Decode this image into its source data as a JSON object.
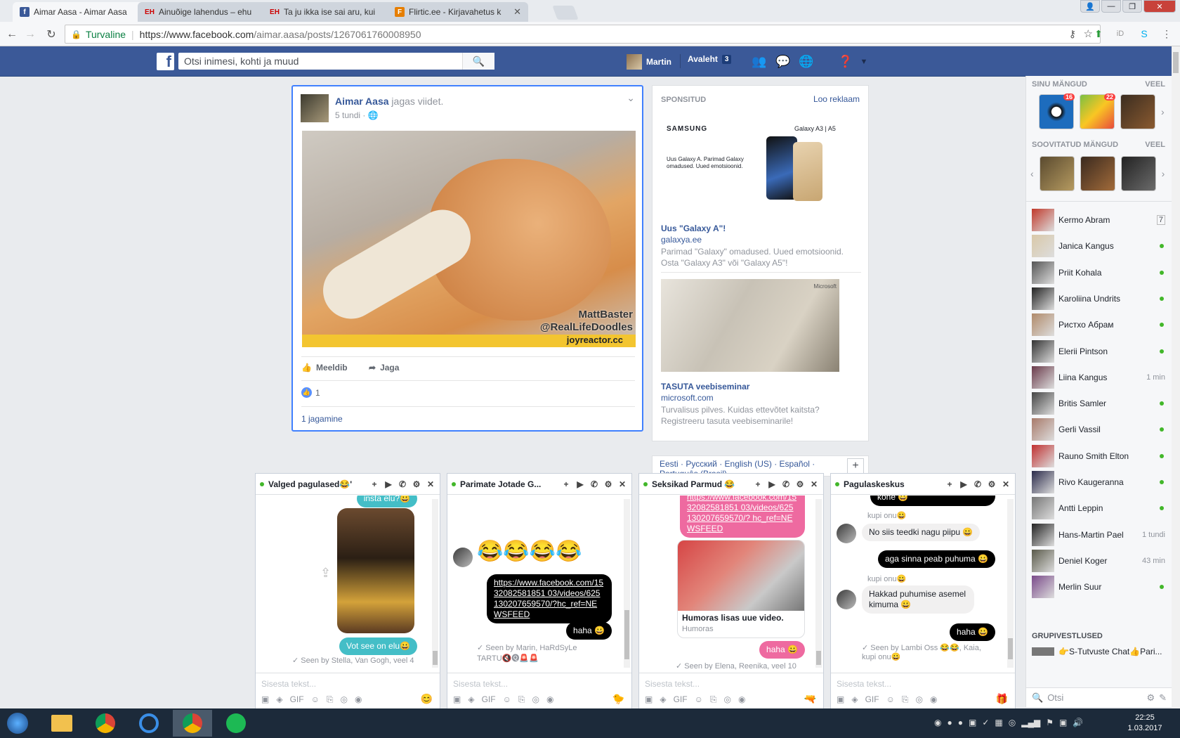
{
  "browser": {
    "tabs": [
      {
        "title": "Aimar Aasa - Aimar Aasa",
        "favicon": "facebook-icon",
        "active": true
      },
      {
        "title": "Ainuõige lahendus – ehu",
        "favicon": "eh-icon",
        "active": false
      },
      {
        "title": "Ta ju ikka ise sai aru, kui",
        "favicon": "eh-icon",
        "active": false
      },
      {
        "title": "Flirtic.ee - Kirjavahetus k",
        "favicon": "flirtic-icon",
        "active": false
      }
    ],
    "security_label": "Turvaline",
    "url_host": "https://www.facebook.com",
    "url_path": "/aimar.aasa/posts/1267061760008950"
  },
  "fb_header": {
    "search_placeholder": "Otsi inimesi, kohti ja muud",
    "user_name": "Martin",
    "home_label": "Avaleht",
    "home_count": "3"
  },
  "post": {
    "author": "Aimar Aasa",
    "action": "jagas viidet.",
    "time": "5 tundi",
    "image_watermark_1": "MattBaster",
    "image_watermark_2": "@RealLifeDoodles",
    "image_source": "joyreactor.cc",
    "like_label": "Meeldib",
    "share_label": "Jaga",
    "like_count": "1",
    "share_count": "1 jagamine"
  },
  "sponsored": {
    "header": "SPONSITUD",
    "create_ad": "Loo reklaam",
    "ads": [
      {
        "brand": "SAMSUNG",
        "product": "Galaxy A3 | A5",
        "img_text": "Uus Galaxy A. Parimad Galaxy omadused. Uued emotsioonid.",
        "title": "Uus \"Galaxy A\"!",
        "domain": "galaxya.ee",
        "desc": "Parimad \"Galaxy\" omadused. Uued emotsioonid. Osta \"Galaxy A3\" või \"Galaxy A5\"!"
      },
      {
        "brand": "Microsoft",
        "title": "TASUTA veebiseminar",
        "domain": "microsoft.com",
        "desc": "Turvalisus pilves. Kuidas ettevõtet kaitsta? Registreeru tasuta veebiseminarile!"
      }
    ]
  },
  "footer": {
    "langs": "Eesti · Русский · English (US) · Español · Português (Brasil)",
    "plus": "+"
  },
  "sidebar": {
    "games_header": "SINU MÄNGUD",
    "more": "VEEL",
    "games_badges": [
      "16",
      "22"
    ],
    "suggested_header": "SOOVITATUD MÄNGUD",
    "friends": [
      {
        "name": "Kermo Abram",
        "status": "7"
      },
      {
        "name": "Janica Kangus",
        "status": "online"
      },
      {
        "name": "Priit Kohala",
        "status": "online"
      },
      {
        "name": "Karoliina Undrits",
        "status": "online"
      },
      {
        "name": "Ристхо Абрам",
        "status": "online"
      },
      {
        "name": "Elerii Pintson",
        "status": "online"
      },
      {
        "name": "Liina Kangus",
        "status": "1 min"
      },
      {
        "name": "Britis Samler",
        "status": "online"
      },
      {
        "name": "Gerli Vassil",
        "status": "online"
      },
      {
        "name": "Rauno Smith Elton",
        "status": "online"
      },
      {
        "name": "Rivo Kaugeranna",
        "status": "online"
      },
      {
        "name": "Antti Leppin",
        "status": "online"
      },
      {
        "name": "Hans-Martin Pael",
        "status": "1 tundi"
      },
      {
        "name": "Deniel Koger",
        "status": "43 min"
      },
      {
        "name": "Merlin Suur",
        "status": "online"
      }
    ],
    "groups_header": "GRUPIVESTLUSED",
    "group": "👉S-Tutvuste Chat👍Pari...",
    "search_placeholder": "Otsi"
  },
  "chats": [
    {
      "title": "Valged pagulased😂'",
      "messages": [
        "insta elu?😀",
        "Vot see on elu😀"
      ],
      "seen": "Seen by Stella, Van Gogh, veel 4",
      "input_placeholder": "Sisesta tekst..."
    },
    {
      "title": "Parimate Jotade G...",
      "emoji": "😂😂😂😂",
      "link": "https://www.facebook.com/1532082581851 03/videos/625130207659570/?hc_ref=NEWSFEED",
      "reply": "haha 😀",
      "seen": "Seen by Marin, HaRdSyLe TARTU🔇🅠🚨🚨",
      "input_placeholder": "Sisesta tekst..."
    },
    {
      "title": "Seksikad Parmud 😂",
      "link": "https://www.facebook.com/1532082581851 03/videos/625130207659570/? hc_ref=NEWSFEED",
      "video_title": "Humoras lisas uue video.",
      "video_source": "Humoras",
      "reply": "haha 😀",
      "seen": "Seen by Elena, Reenika, veel 10",
      "input_placeholder": "Sisesta tekst..."
    },
    {
      "title": "Pagulaskeskus",
      "messages": [
        {
          "text": "kõne 😀",
          "from": "me"
        },
        {
          "sender": "kupi onu😀",
          "text": "No siis teedki nagu piipu 😀"
        },
        {
          "text": "aga sinna peab puhuma 😀",
          "from": "me"
        },
        {
          "sender": "kupi onu😀",
          "text": "Hakkad puhumise asemel kimuma 😀"
        },
        {
          "text": "haha 😀",
          "from": "me"
        }
      ],
      "seen": "Seen by Lambi Oss 😂😂, Kaia, kupi onu😀",
      "input_placeholder": "Sisesta tekst..."
    }
  ],
  "taskbar": {
    "time": "22:25",
    "date": "1.03.2017"
  },
  "colors": {
    "fb_blue": "#3b5998",
    "link": "#365899",
    "online": "#42b72a"
  }
}
